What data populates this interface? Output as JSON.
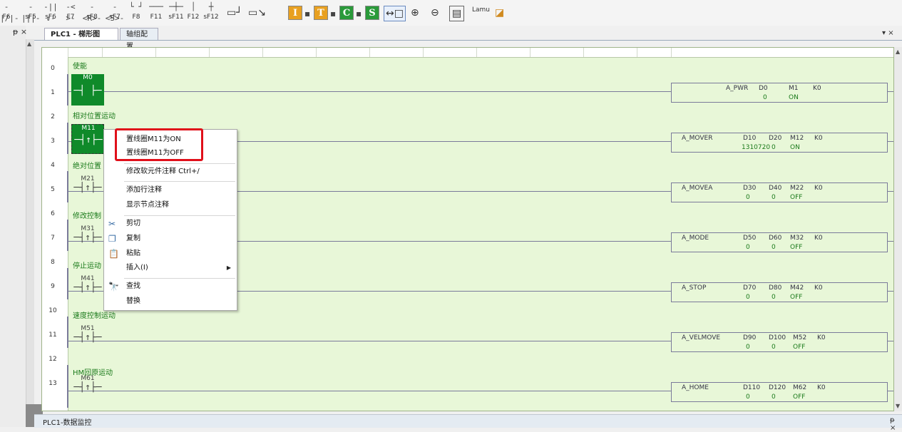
{
  "toolbar": {
    "items": [
      {
        "sym": "-|/|-",
        "key": "F6"
      },
      {
        "sym": "-|||-",
        "key": "sF5"
      },
      {
        "sym": "-||↓-",
        "key": "sF6"
      },
      {
        "sym": "-< >-",
        "key": "F7"
      },
      {
        "sym": "-<R>-",
        "key": "sF8"
      },
      {
        "sym": "-<S>-",
        "key": "sF7"
      },
      {
        "sym": "└ ┘",
        "key": "F8"
      },
      {
        "sym": "───",
        "key": "F11"
      },
      {
        "sym": "─┼─",
        "key": "sF11"
      },
      {
        "sym": "│",
        "key": "F12"
      },
      {
        "sym": "┼",
        "key": "sF12"
      }
    ],
    "letter_buttons": [
      {
        "letter": "I",
        "color": "#e8a020"
      },
      {
        "letter": "T",
        "color": "#e8a020"
      },
      {
        "letter": "C",
        "color": "#2a9a3a"
      },
      {
        "letter": "S",
        "color": "#2a9a3a"
      }
    ],
    "extra_label": "Lamu",
    "zoom_in_icon": "zoom-in-icon",
    "zoom_out_icon": "zoom-out-icon"
  },
  "panel": {
    "pin_left": "ᵽ ×",
    "tab_menu": "▾ ×"
  },
  "tabs": [
    {
      "label": "PLC1 - 梯形图",
      "active": true
    },
    {
      "label": "轴组配置",
      "active": false
    }
  ],
  "ladder": {
    "rows": [
      "0",
      "1",
      "2",
      "3",
      "4",
      "5",
      "6",
      "7",
      "8",
      "9",
      "10",
      "11",
      "12",
      "13"
    ],
    "comments": [
      {
        "row": "0",
        "text": "使能"
      },
      {
        "row": "2",
        "text": "相对位置运动"
      },
      {
        "row": "4",
        "text": "绝对位置"
      },
      {
        "row": "6",
        "text": "修改控制"
      },
      {
        "row": "8",
        "text": "停止运动"
      },
      {
        "row": "10",
        "text": "速度控制运动"
      },
      {
        "row": "12",
        "text": "HM回原运动"
      }
    ],
    "contacts": [
      {
        "label": "M0",
        "sym": "─┤ ├─",
        "on": true
      },
      {
        "label": "M11",
        "sym": "─┤↑├─",
        "on": true
      },
      {
        "label": "M21",
        "sym": "─┤↑├─",
        "on": false
      },
      {
        "label": "M31",
        "sym": "─┤↑├─",
        "on": false
      },
      {
        "label": "M41",
        "sym": "─┤↑├─",
        "on": false
      },
      {
        "label": "M51",
        "sym": "─┤↑├─",
        "on": false
      },
      {
        "label": "M61",
        "sym": "─┤↑├─",
        "on": false
      }
    ],
    "blocks": [
      {
        "name": "A_PWR",
        "ops": [
          "D0",
          "M1",
          "K0"
        ],
        "vals": [
          "0",
          "ON",
          ""
        ]
      },
      {
        "name": "A_MOVER",
        "ops": [
          "D10",
          "D20",
          "M12",
          "K0"
        ],
        "vals": [
          "1310720",
          "0",
          "ON",
          ""
        ]
      },
      {
        "name": "A_MOVEA",
        "ops": [
          "D30",
          "D40",
          "M22",
          "K0"
        ],
        "vals": [
          "0",
          "0",
          "OFF",
          ""
        ]
      },
      {
        "name": "A_MODE",
        "ops": [
          "D50",
          "D60",
          "M32",
          "K0"
        ],
        "vals": [
          "0",
          "0",
          "OFF",
          ""
        ]
      },
      {
        "name": "A_STOP",
        "ops": [
          "D70",
          "D80",
          "M42",
          "K0"
        ],
        "vals": [
          "0",
          "0",
          "OFF",
          ""
        ]
      },
      {
        "name": "A_VELMOVE",
        "ops": [
          "D90",
          "D100",
          "M52",
          "K0"
        ],
        "vals": [
          "0",
          "0",
          "OFF",
          ""
        ]
      },
      {
        "name": "A_HOME",
        "ops": [
          "D110",
          "D120",
          "M62",
          "K0"
        ],
        "vals": [
          "0",
          "0",
          "OFF",
          ""
        ]
      }
    ]
  },
  "context_menu": {
    "items": [
      {
        "label": "置线圈M11为ON",
        "icon": ""
      },
      {
        "label": "置线圈M11为OFF",
        "icon": ""
      },
      {
        "label": "修改软元件注释  Ctrl+/",
        "icon": ""
      },
      {
        "label": "添加行注释",
        "icon": ""
      },
      {
        "label": "显示节点注释",
        "icon": ""
      },
      {
        "label": "剪切",
        "icon": "cut-icon"
      },
      {
        "label": "复制",
        "icon": "copy-icon"
      },
      {
        "label": "粘贴",
        "icon": "paste-icon"
      },
      {
        "label": "插入(I)",
        "icon": ""
      },
      {
        "label": "查找",
        "icon": "find-icon"
      },
      {
        "label": "替换",
        "icon": ""
      }
    ]
  },
  "status": {
    "text": "PLC1-数据监控",
    "ctrl": "ᵽ ×"
  }
}
